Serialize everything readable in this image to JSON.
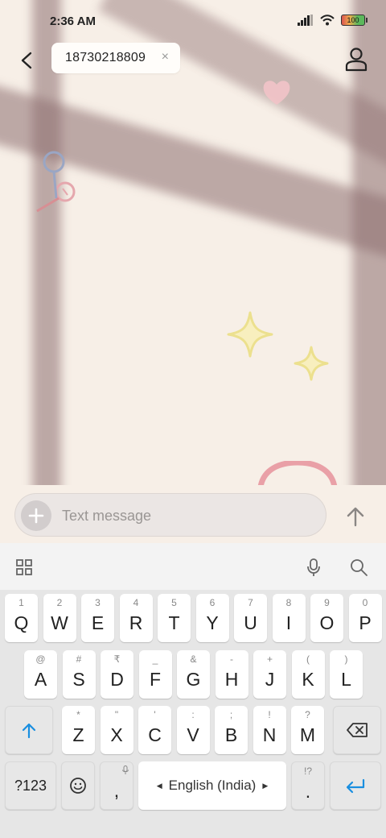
{
  "status_bar": {
    "time": "2:36 AM",
    "battery": "100"
  },
  "header": {
    "recipient": "18730218809",
    "remove_symbol": "×"
  },
  "compose": {
    "placeholder": "Text message"
  },
  "keyboard": {
    "row1": [
      {
        "sub": "1",
        "main": "Q"
      },
      {
        "sub": "2",
        "main": "W"
      },
      {
        "sub": "3",
        "main": "E"
      },
      {
        "sub": "4",
        "main": "R"
      },
      {
        "sub": "5",
        "main": "T"
      },
      {
        "sub": "6",
        "main": "Y"
      },
      {
        "sub": "7",
        "main": "U"
      },
      {
        "sub": "8",
        "main": "I"
      },
      {
        "sub": "9",
        "main": "O"
      },
      {
        "sub": "0",
        "main": "P"
      }
    ],
    "row2": [
      {
        "sub": "@",
        "main": "A"
      },
      {
        "sub": "#",
        "main": "S"
      },
      {
        "sub": "₹",
        "main": "D"
      },
      {
        "sub": "_",
        "main": "F"
      },
      {
        "sub": "&",
        "main": "G"
      },
      {
        "sub": "-",
        "main": "H"
      },
      {
        "sub": "+",
        "main": "J"
      },
      {
        "sub": "(",
        "main": "K"
      },
      {
        "sub": ")",
        "main": "L"
      }
    ],
    "row3": [
      {
        "sub": "*",
        "main": "Z"
      },
      {
        "sub": "\"",
        "main": "X"
      },
      {
        "sub": "'",
        "main": "C"
      },
      {
        "sub": ":",
        "main": "V"
      },
      {
        "sub": ";",
        "main": "B"
      },
      {
        "sub": "!",
        "main": "N"
      },
      {
        "sub": "?",
        "main": "M"
      }
    ],
    "symbols_label": "?123",
    "comma": ",",
    "space_label": "English (India)",
    "period_sub": "!?",
    "period": "."
  },
  "colors": {
    "accent": "#1a8fe0",
    "wallpaper": "#f7efe7"
  }
}
